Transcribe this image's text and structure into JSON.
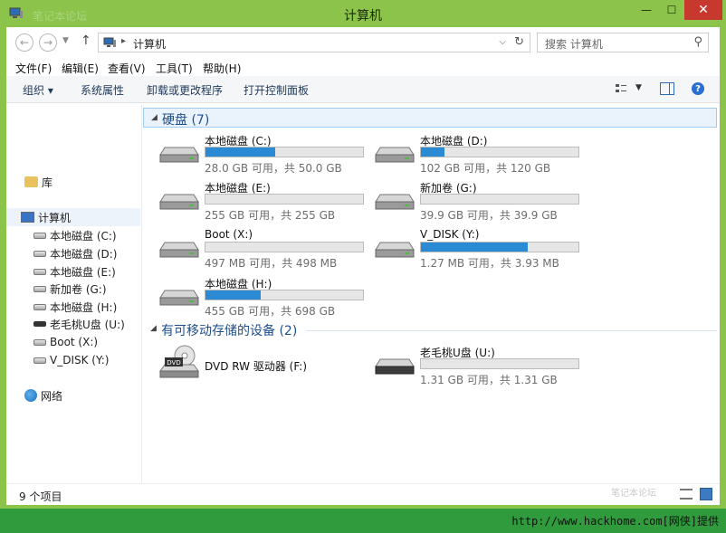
{
  "window": {
    "title": "计算机",
    "watermark": "笔记本论坛",
    "minimize_glyph": "—",
    "maximize_glyph": "☐",
    "close_glyph": "✕"
  },
  "address": {
    "path": "计算机",
    "search_placeholder": "搜索 计算机"
  },
  "menu": [
    "文件(F)",
    "编辑(E)",
    "查看(V)",
    "工具(T)",
    "帮助(H)"
  ],
  "toolbar": {
    "organize": "组织 ▾",
    "properties": "系统属性",
    "uninstall": "卸载或更改程序",
    "control_panel": "打开控制面板"
  },
  "sidebar": {
    "libraries": "库",
    "computer": "计算机",
    "drives": [
      {
        "label": "本地磁盘 (C:)",
        "kind": "hdd"
      },
      {
        "label": "本地磁盘 (D:)",
        "kind": "hdd"
      },
      {
        "label": "本地磁盘 (E:)",
        "kind": "hdd"
      },
      {
        "label": "新加卷 (G:)",
        "kind": "hdd"
      },
      {
        "label": "本地磁盘 (H:)",
        "kind": "hdd"
      },
      {
        "label": "老毛桃U盘 (U:)",
        "kind": "usb"
      },
      {
        "label": "Boot (X:)",
        "kind": "hdd"
      },
      {
        "label": "V_DISK (Y:)",
        "kind": "hdd"
      }
    ],
    "network": "网络"
  },
  "groups": {
    "hdd_title": "硬盘 (7)",
    "removable_title": "有可移动存储的设备 (2)"
  },
  "drives": [
    {
      "name": "本地磁盘 (C:)",
      "info": "28.0 GB 可用，共 50.0 GB",
      "used_fraction": 0.44
    },
    {
      "name": "本地磁盘 (D:)",
      "info": "102 GB 可用，共 120 GB",
      "used_fraction": 0.15
    },
    {
      "name": "本地磁盘 (E:)",
      "info": "255 GB 可用，共 255 GB",
      "used_fraction": 0.0
    },
    {
      "name": "新加卷 (G:)",
      "info": "39.9 GB 可用，共 39.9 GB",
      "used_fraction": 0.0
    },
    {
      "name": "Boot (X:)",
      "info": "497 MB 可用，共 498 MB",
      "used_fraction": 0.0
    },
    {
      "name": "V_DISK (Y:)",
      "info": "1.27 MB 可用，共 3.93 MB",
      "used_fraction": 0.68
    },
    {
      "name": "本地磁盘 (H:)",
      "info": "455 GB 可用，共 698 GB",
      "used_fraction": 0.35
    }
  ],
  "removable": [
    {
      "name": "DVD RW 驱动器 (F:)",
      "info": "",
      "icon_label": "DVD"
    },
    {
      "name": "老毛桃U盘 (U:)",
      "info": "1.31 GB 可用，共 1.31 GB",
      "used_fraction": 0.0
    }
  ],
  "status": {
    "item_count": "9 个项目",
    "watermark": "笔记本论坛"
  },
  "footer": {
    "credit": "http://www.hackhome.com[网侠]提供"
  }
}
